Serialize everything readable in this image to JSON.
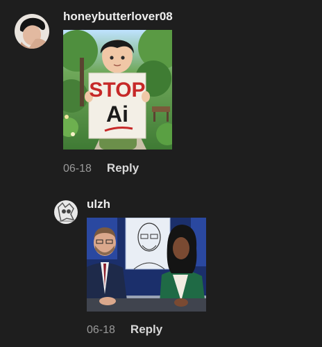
{
  "comments": [
    {
      "username": "honeybutterlover08",
      "date": "06-18",
      "reply_label": "Reply",
      "image": {
        "sign_line1": "STOP",
        "sign_line2": "Ai"
      }
    },
    {
      "username": "ulzh",
      "date": "06-18",
      "reply_label": "Reply"
    }
  ],
  "colors": {
    "background": "#1e1e1e",
    "sign_text": "#c62828"
  }
}
